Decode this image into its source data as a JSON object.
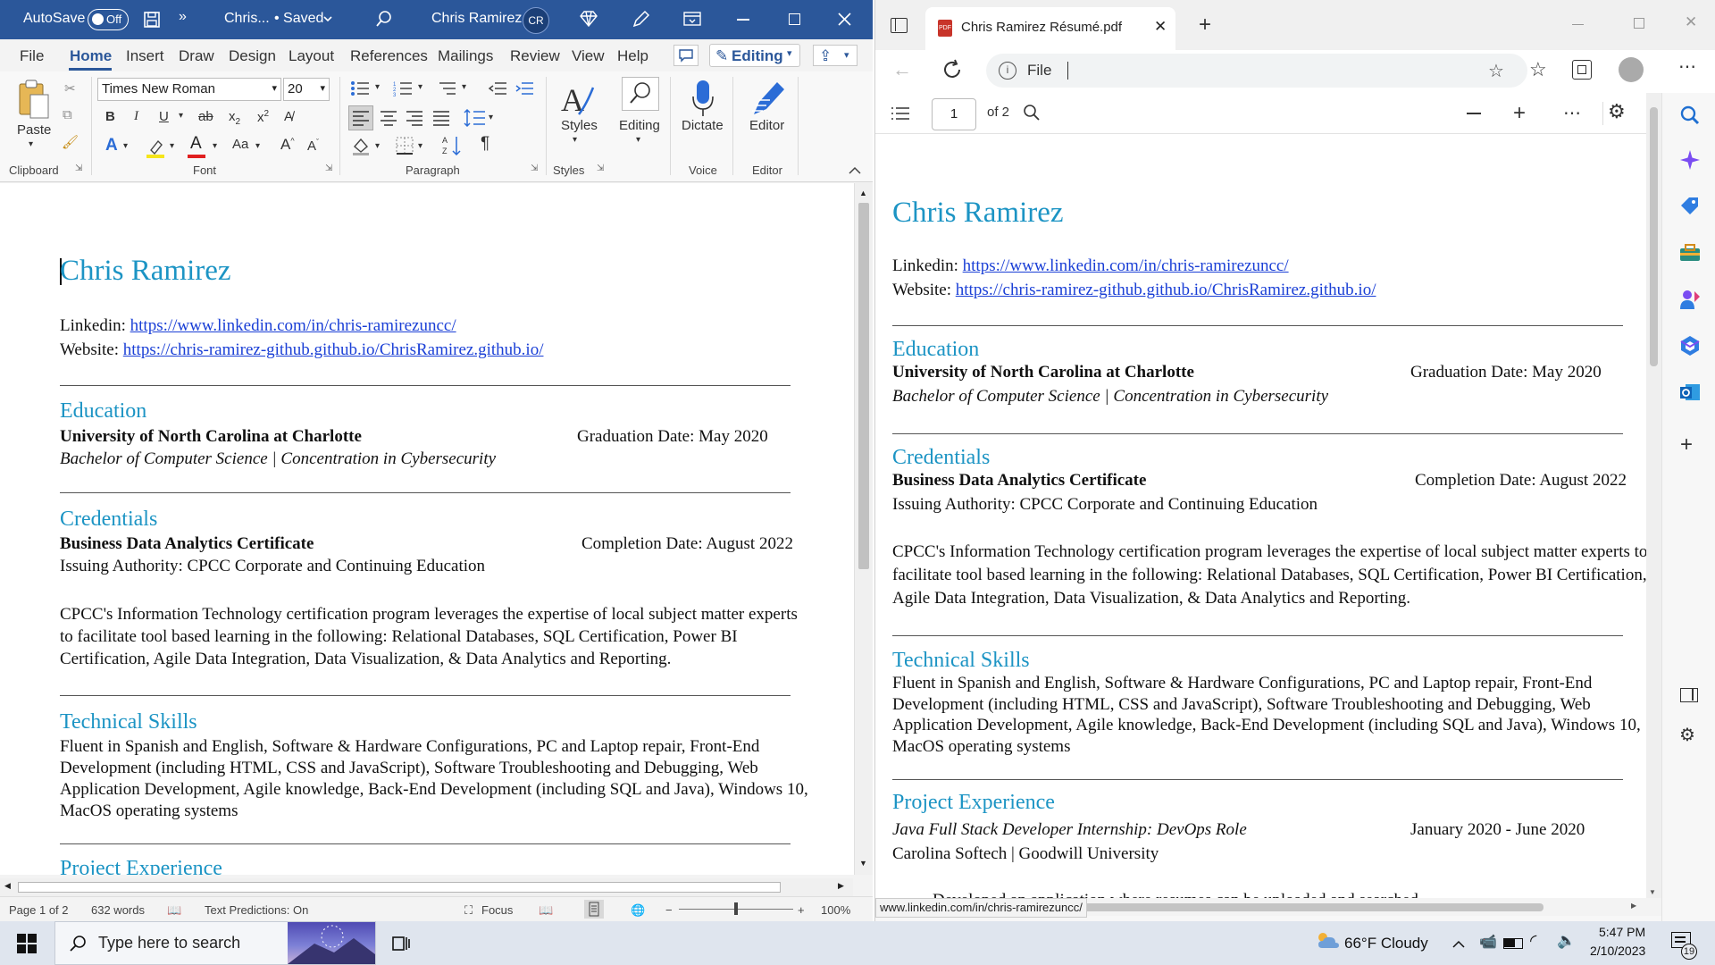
{
  "word": {
    "autosave_label": "AutoSave",
    "autosave_state": "Off",
    "doc_title": "Chris...",
    "saved_label": "• Saved",
    "user_name": "Chris Ramirez",
    "user_initials": "CR",
    "tabs": [
      "File",
      "Home",
      "Insert",
      "Draw",
      "Design",
      "Layout",
      "References",
      "Mailings",
      "Review",
      "View",
      "Help"
    ],
    "editing_label": "Editing",
    "ribbon": {
      "paste_label": "Paste",
      "clipboard_label": "Clipboard",
      "font_name": "Times New Roman",
      "font_size": "20",
      "font_label": "Font",
      "paragraph_label": "Paragraph",
      "styles_button": "Styles",
      "styles_label": "Styles",
      "editing_button": "Editing",
      "dictate_button": "Dictate",
      "voice_label": "Voice",
      "editor_button": "Editor",
      "editor_label": "Editor"
    },
    "status": {
      "page": "Page 1 of 2",
      "words": "632 words",
      "text_predictions": "Text Predictions: On",
      "focus": "Focus",
      "zoom": "100%"
    }
  },
  "resume": {
    "name": "Chris Ramirez",
    "linkedin_label": "Linkedin:",
    "linkedin_url": "https://www.linkedin.com/in/chris-ramirezuncc/",
    "website_label": "Website:",
    "website_url": "https://chris-ramirez-github.github.io/ChrisRamirez.github.io/",
    "education_heading": "Education",
    "school": "University of North Carolina at Charlotte",
    "graduation": "Graduation Date: May 2020",
    "degree": "Bachelor of Computer Science | Concentration in Cybersecurity",
    "credentials_heading": "Credentials",
    "certificate": "Business Data Analytics Certificate",
    "completion": "Completion Date: August 2022",
    "issuer": "Issuing Authority: CPCC Corporate and Continuing Education",
    "cert_paragraph": "CPCC's Information Technology certification program leverages the expertise of local subject matter experts to facilitate tool based learning in the following: Relational Databases, SQL Certification, Power BI Certification, Agile Data Integration, Data Visualization, & Data Analytics and Reporting.",
    "skills_heading": "Technical Skills",
    "skills_paragraph": "Fluent in Spanish and English, Software & Hardware Configurations, PC and Laptop repair, Front-End Development (including HTML, CSS and JavaScript), Software Troubleshooting and Debugging, Web Application Development, Agile knowledge, Back-End Development (including SQL and Java), Windows 10, MacOS operating systems",
    "project_heading": "Project Experience",
    "project_role": "Java Full Stack Developer Internship: DevOps Role",
    "project_dates": "January 2020 - June 2020",
    "project_org": "Carolina Softech | Goodwill University",
    "project_bullet_partial": "Developed an application where resumes can be uploaded and searched"
  },
  "edge": {
    "tab_title": "Chris Ramirez Résumé.pdf",
    "address_label": "File",
    "pdf_page": "1",
    "pdf_of": "of 2",
    "status_url": "www.linkedin.com/in/chris-ramirezuncc/"
  },
  "taskbar": {
    "search_placeholder": "Type here to search",
    "weather": "66°F  Cloudy",
    "time": "5:47 PM",
    "date": "2/10/2023",
    "notification_count": "19"
  },
  "colors": {
    "word_blue": "#2b579a",
    "heading_teal": "#1c94c4",
    "link_blue": "#1a3fd6"
  }
}
